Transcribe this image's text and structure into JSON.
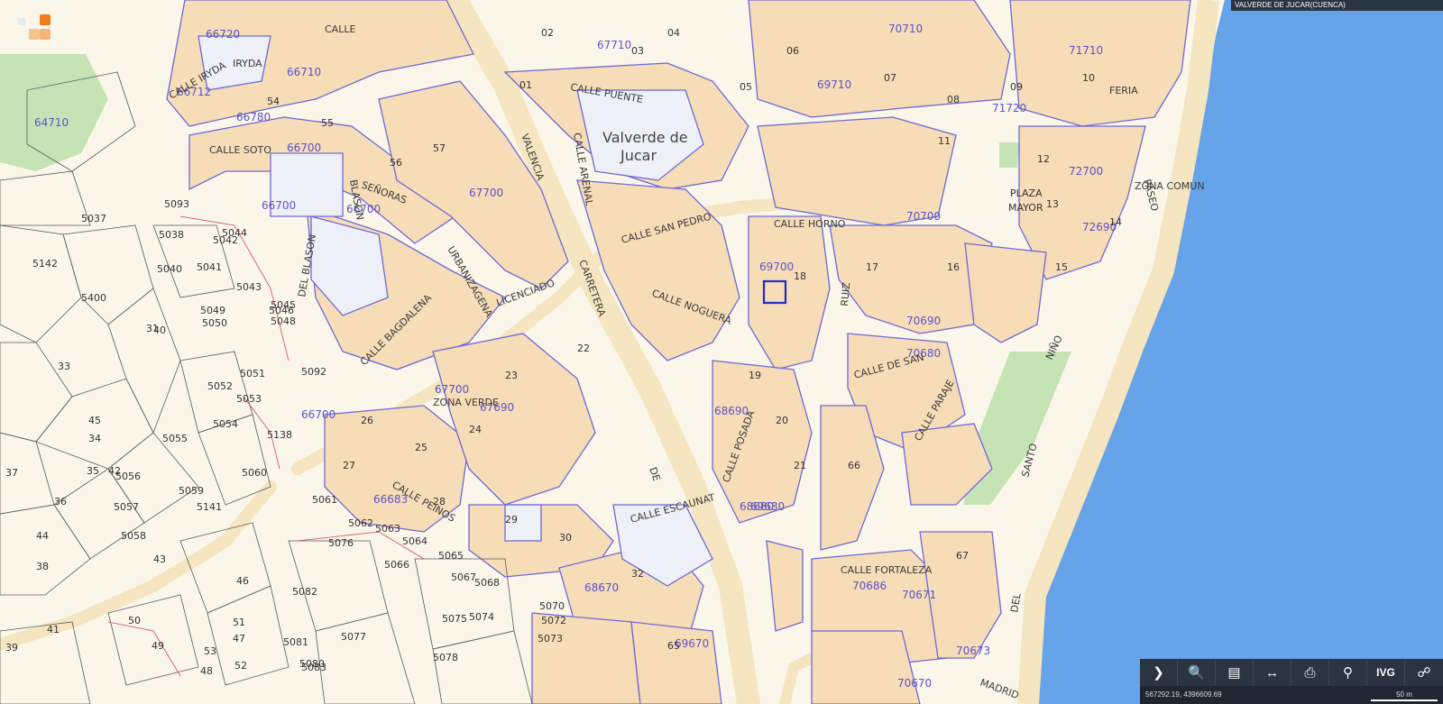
{
  "window": {
    "title": "VALVERDE DE JUCAR(CUENCA)"
  },
  "status": {
    "coordinates": "567292.19, 4396609.69",
    "scale_label": "50 m"
  },
  "toolbar": {
    "items": [
      {
        "icon": "chevron-right-icon",
        "glyph": "❯"
      },
      {
        "icon": "search-icon",
        "glyph": "🔍"
      },
      {
        "icon": "layers-icon",
        "glyph": "▤"
      },
      {
        "icon": "measure-icon",
        "glyph": "↔"
      },
      {
        "icon": "print-icon",
        "glyph": "⎙"
      },
      {
        "icon": "location-pin-icon",
        "glyph": "⚲"
      },
      {
        "icon": "ivg-text-icon",
        "glyph": "IVG"
      },
      {
        "icon": "group-icon",
        "glyph": "☍"
      }
    ]
  },
  "map": {
    "colors": {
      "background": "#fbf6ea",
      "block": "#f6dcb7",
      "parcel_line": "#6d68d6",
      "road": "#f5e5c0",
      "water": "#66a3e8",
      "park": "#c6e3b6"
    },
    "place_labels": [
      "Valverde de",
      "Jucar",
      "PLAZA",
      "MAYOR"
    ],
    "street_labels": [
      "CALLE IRYDA",
      "CALLE",
      "IRYDA",
      "CALLE SOTO",
      "SEÑORAS",
      "BLASON",
      "DEL BLASON",
      "URBANIZAGENA",
      "CALLE BAGDALENA",
      "LICENCIADO",
      "VALENCIA",
      "CARRETERA",
      "CALLE PUENTE",
      "CALLE ARENAL",
      "CALLE SAN PEDRO",
      "CALLE NOGUERA",
      "CALLE HORNO",
      "CALLE POSADA",
      "CALLE ESCAUNAT",
      "CALLE PEINOS",
      "CALLE FORTALEZA",
      "CALLE DE SAN",
      "PASEO",
      "CALLE PARAJE",
      "ZONA COMUN",
      "ZONA VERDE",
      "NIÑO",
      "SANTO",
      "DEL",
      "MADRID",
      "RUIZ",
      "DE",
      "FERIA"
    ],
    "zone_labels": [
      "66720",
      "66710",
      "66712",
      "66780",
      "66700",
      "66700",
      "67700",
      "67710",
      "66700",
      "67690",
      "69700",
      "68690",
      "68680",
      "68670",
      "69680",
      "69670",
      "70680",
      "70700",
      "70710",
      "71710",
      "72700",
      "72690",
      "71720",
      "69710",
      "70690",
      "70670",
      "70671",
      "70686",
      "70673",
      "64710",
      "66683",
      "67700",
      "66700"
    ],
    "parcel_numbers": [
      "5037",
      "5038",
      "5040",
      "5041",
      "5042",
      "5043",
      "5044",
      "5045",
      "5046",
      "5048",
      "5049",
      "5050",
      "5051",
      "5052",
      "5053",
      "5054",
      "5055",
      "5056",
      "5057",
      "5058",
      "5059",
      "5060",
      "5061",
      "5062",
      "5063",
      "5064",
      "5065",
      "5066",
      "5067",
      "5068",
      "5070",
      "5072",
      "5073",
      "5074",
      "5075",
      "5076",
      "5077",
      "5078",
      "5080",
      "5081",
      "5082",
      "5083",
      "5092",
      "5093",
      "5138",
      "5141",
      "5142",
      "5400",
      "31",
      "33",
      "34",
      "35",
      "36",
      "37",
      "38",
      "39",
      "40",
      "41",
      "42",
      "43",
      "44",
      "45",
      "46",
      "47",
      "48",
      "49",
      "50",
      "51",
      "52",
      "53",
      "54",
      "55",
      "56",
      "57",
      "01",
      "02",
      "03",
      "04",
      "05",
      "06",
      "07",
      "08",
      "09",
      "10",
      "11",
      "12",
      "13",
      "14",
      "15",
      "16",
      "17",
      "18",
      "19",
      "20",
      "21",
      "22",
      "23",
      "24",
      "25",
      "26",
      "27",
      "28",
      "29",
      "30",
      "32",
      "65",
      "66",
      "67"
    ]
  }
}
